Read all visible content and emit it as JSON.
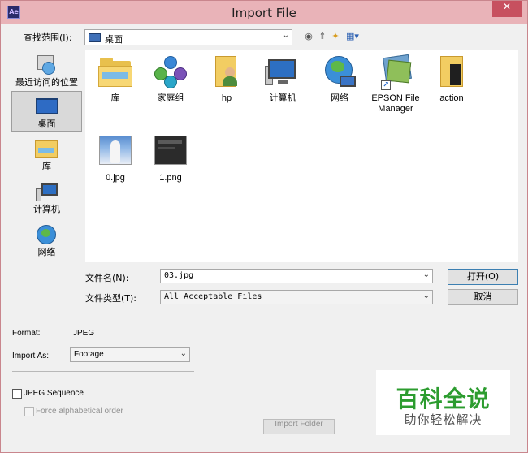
{
  "window": {
    "title": "Import File",
    "app_icon": "Ae",
    "close_glyph": "✕"
  },
  "lookin": {
    "label": "查找范围(I):",
    "value": "桌面"
  },
  "toolbar": {
    "back_glyph": "◉",
    "up_glyph": "⇑",
    "newfolder_glyph": "✦",
    "view_glyph": "▦▾"
  },
  "places": [
    {
      "label": "最近访问的位置",
      "icon": "recent-places-icon"
    },
    {
      "label": "桌面",
      "icon": "desktop-icon",
      "selected": true
    },
    {
      "label": "库",
      "icon": "libraries-icon"
    },
    {
      "label": "计算机",
      "icon": "computer-icon"
    },
    {
      "label": "网络",
      "icon": "network-icon"
    }
  ],
  "files": [
    {
      "label": "库",
      "icon": "libraries-icon"
    },
    {
      "label": "家庭组",
      "icon": "homegroup-icon"
    },
    {
      "label": "hp",
      "icon": "user-folder-icon"
    },
    {
      "label": "计算机",
      "icon": "computer-icon"
    },
    {
      "label": "网络",
      "icon": "network-icon"
    },
    {
      "label": "EPSON File Manager",
      "icon": "shortcut-icon"
    },
    {
      "label": "action",
      "icon": "folder-icon"
    },
    {
      "label": "0.jpg",
      "icon": "image-thumbnail-icon"
    },
    {
      "label": "1.png",
      "icon": "image-thumbnail-icon"
    }
  ],
  "filename": {
    "label": "文件名(N):",
    "value": "03.jpg"
  },
  "filetype": {
    "label": "文件类型(T):",
    "value": "All Acceptable Files"
  },
  "buttons": {
    "open": "打开(O)",
    "cancel": "取消",
    "import_folder": "Import Folder"
  },
  "options": {
    "format_label": "Format:",
    "format_value": "JPEG",
    "import_as_label": "Import As:",
    "import_as_value": "Footage",
    "jpeg_sequence": "JPEG Sequence",
    "force_alpha": "Force alphabetical order"
  },
  "watermark": {
    "main": "百科全说",
    "sub": "助你轻松解决"
  },
  "dropdown_glyph": "⌄",
  "colors": {
    "titlebar": "#e9b3b8",
    "close": "#c7505f",
    "watermark_green": "#2c9c2f"
  }
}
